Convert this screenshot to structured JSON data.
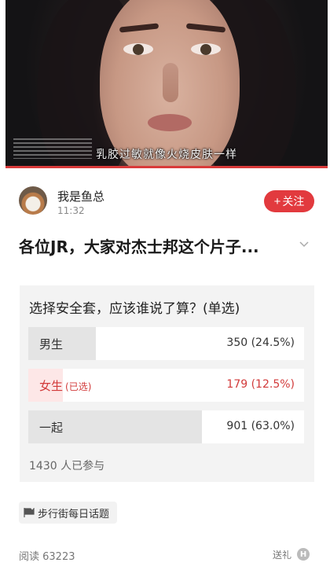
{
  "video": {
    "subtitle": "乳胶过敏就像火烧皮肤一样",
    "progress": 1.0
  },
  "author": {
    "name": "我是鱼总",
    "time": "11:32",
    "follow_plus": "+",
    "follow_label": "关注"
  },
  "post": {
    "title": "各位JR，大家对杰士邦这个片子..."
  },
  "poll": {
    "question": "选择安全套，应该谁说了算？(单选)",
    "options": [
      {
        "label": "男生",
        "tag": "",
        "result": "350 (24.5%)",
        "fraction": 0.245,
        "selected": false
      },
      {
        "label": "女生",
        "tag": "(已选)",
        "result": "179 (12.5%)",
        "fraction": 0.125,
        "selected": true
      },
      {
        "label": "一起",
        "tag": "",
        "result": "901 (63.0%)",
        "fraction": 0.63,
        "selected": false
      }
    ],
    "participants": "1430 人已参与"
  },
  "topic": {
    "label": "步行街每日话题",
    "icon": "flag-icon"
  },
  "footer": {
    "reads": "阅读 63223",
    "gift": "送礼",
    "gift_icon_text": "H"
  },
  "colors": {
    "accent": "#e23a3e",
    "selected_text": "#d23a3a",
    "selected_bar": "#fde7e7",
    "bar": "#e4e4e4"
  }
}
